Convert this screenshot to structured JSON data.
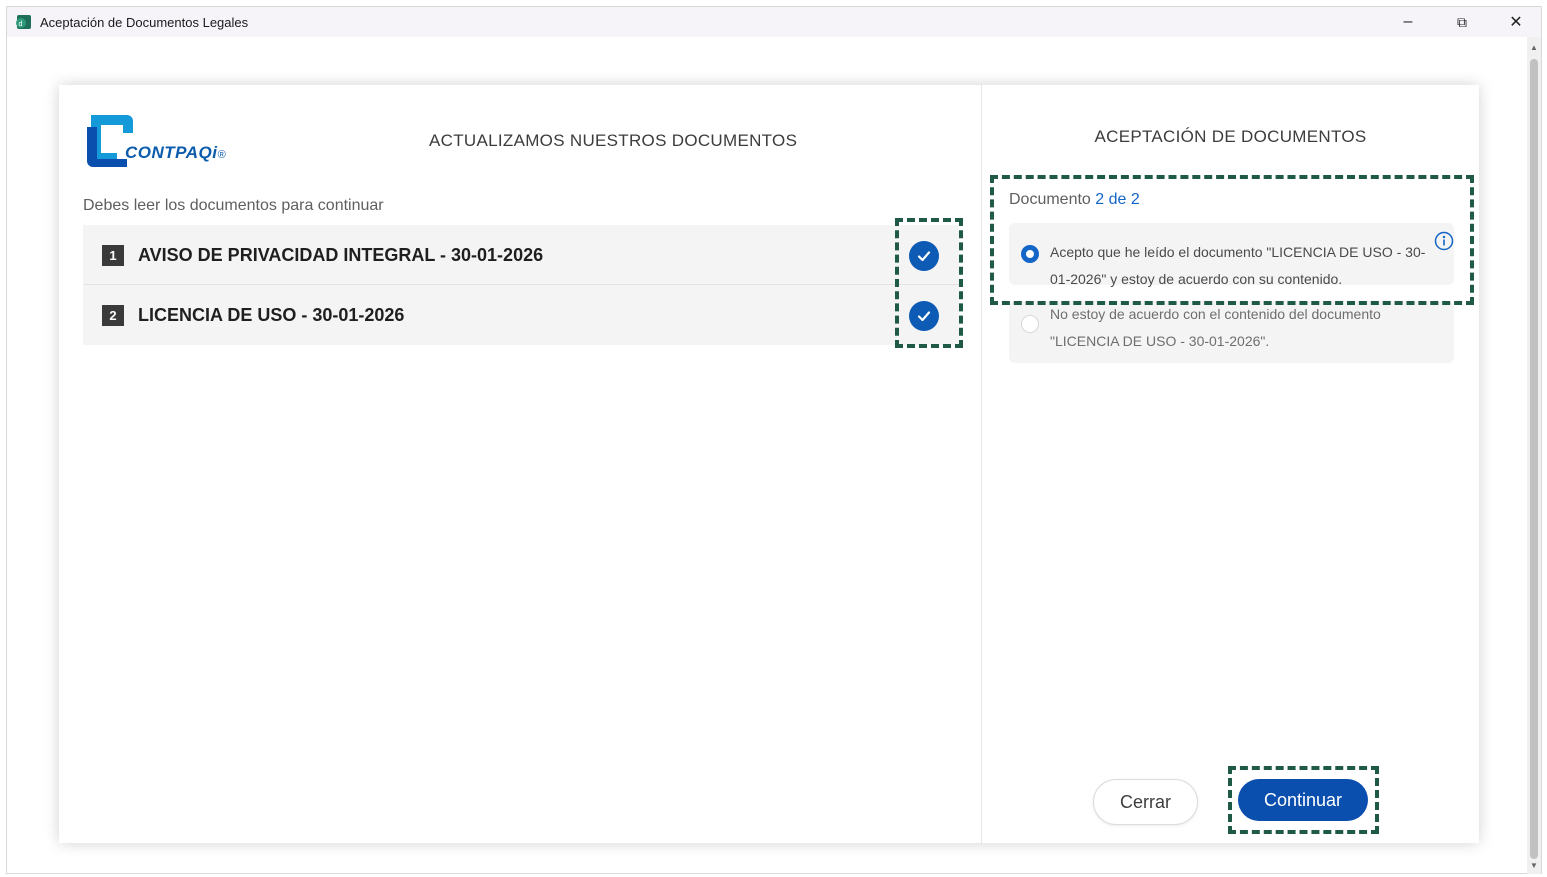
{
  "window": {
    "title": "Aceptación de Documentos Legales",
    "minimize_glyph": "–",
    "maximize_glyph": "⧉",
    "close_glyph": "✕"
  },
  "logo": {
    "text": "CONTPAQi",
    "reg_mark": "®"
  },
  "left_panel": {
    "title": "ACTUALIZAMOS NUESTROS DOCUMENTOS",
    "subtitle": "Debes leer los documentos para continuar",
    "documents": [
      {
        "number": "1",
        "label": "AVISO DE PRIVACIDAD INTEGRAL - 30-01-2026",
        "read": true
      },
      {
        "number": "2",
        "label": "LICENCIA DE USO - 30-01-2026",
        "read": true
      }
    ]
  },
  "right_panel": {
    "title": "ACEPTACIÓN DE DOCUMENTOS",
    "counter_prefix": "Documento",
    "counter_value": "2 de 2",
    "options": [
      {
        "text": "Acepto que he leído el documento \"LICENCIA DE USO - 30-01-2026\" y estoy de acuerdo con su contenido.",
        "selected": true
      },
      {
        "text": "No estoy de acuerdo con el contenido del documento \"LICENCIA DE USO - 30-01-2026\".",
        "selected": false
      }
    ]
  },
  "buttons": {
    "close_label": "Cerrar",
    "continue_label": "Continuar"
  },
  "colors": {
    "accent": "#0b4fae",
    "check": "#0d5bb5",
    "highlight_dash": "#1f5a48",
    "link": "#1466c6"
  },
  "icons": {
    "app": "app-icon",
    "check": "checkmark-icon",
    "info": "info-icon"
  }
}
